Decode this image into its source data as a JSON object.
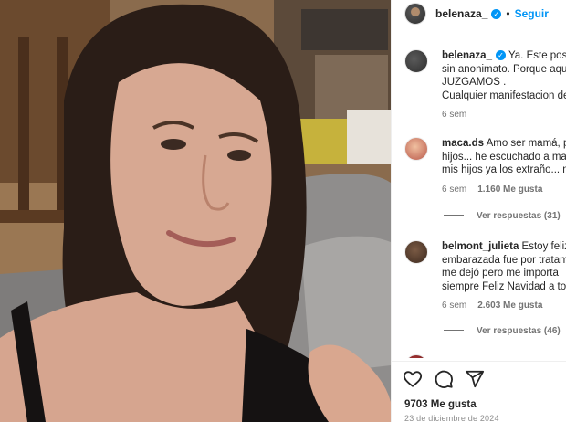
{
  "post": {
    "username": "belenaza_",
    "verified_mark": "✓",
    "follow_label": "Seguir",
    "separator": "•",
    "likes": "9703 Me gusta",
    "date": "23 de diciembre de 2024"
  },
  "caption": {
    "username": "belenaza_",
    "line1": " Ya. Este post e",
    "line2": "sin anonimato. Porque aqui",
    "line3": "JUZGAMOS .",
    "line4": "Cualquier manifestacion de",
    "time": "6 sem"
  },
  "comments": [
    {
      "username": "maca.ds",
      "line1": " Amo ser mamá, pe",
      "line2": "hijos... he escuchado a man",
      "line3": "mis hijos ya los extraño... ne",
      "time": "6 sem",
      "likes": "1.160 Me gusta",
      "replies": "Ver respuestas (31)"
    },
    {
      "username": "belmont_julieta",
      "line1": " Estoy feliz",
      "line2": "embarazada fue por tratam",
      "line3": "me dejó pero me importa",
      "line4": "siempre Feliz Navidad a tod",
      "time": "6 sem",
      "likes": "2.603 Me gusta",
      "replies": "Ver respuestas (46)"
    }
  ],
  "icons": {
    "like": "heart-icon",
    "comment": "comment-icon",
    "share": "share-icon",
    "verified": "verified-badge-icon"
  },
  "colors": {
    "link": "#0095f6",
    "muted": "#737373",
    "text": "#262626"
  }
}
